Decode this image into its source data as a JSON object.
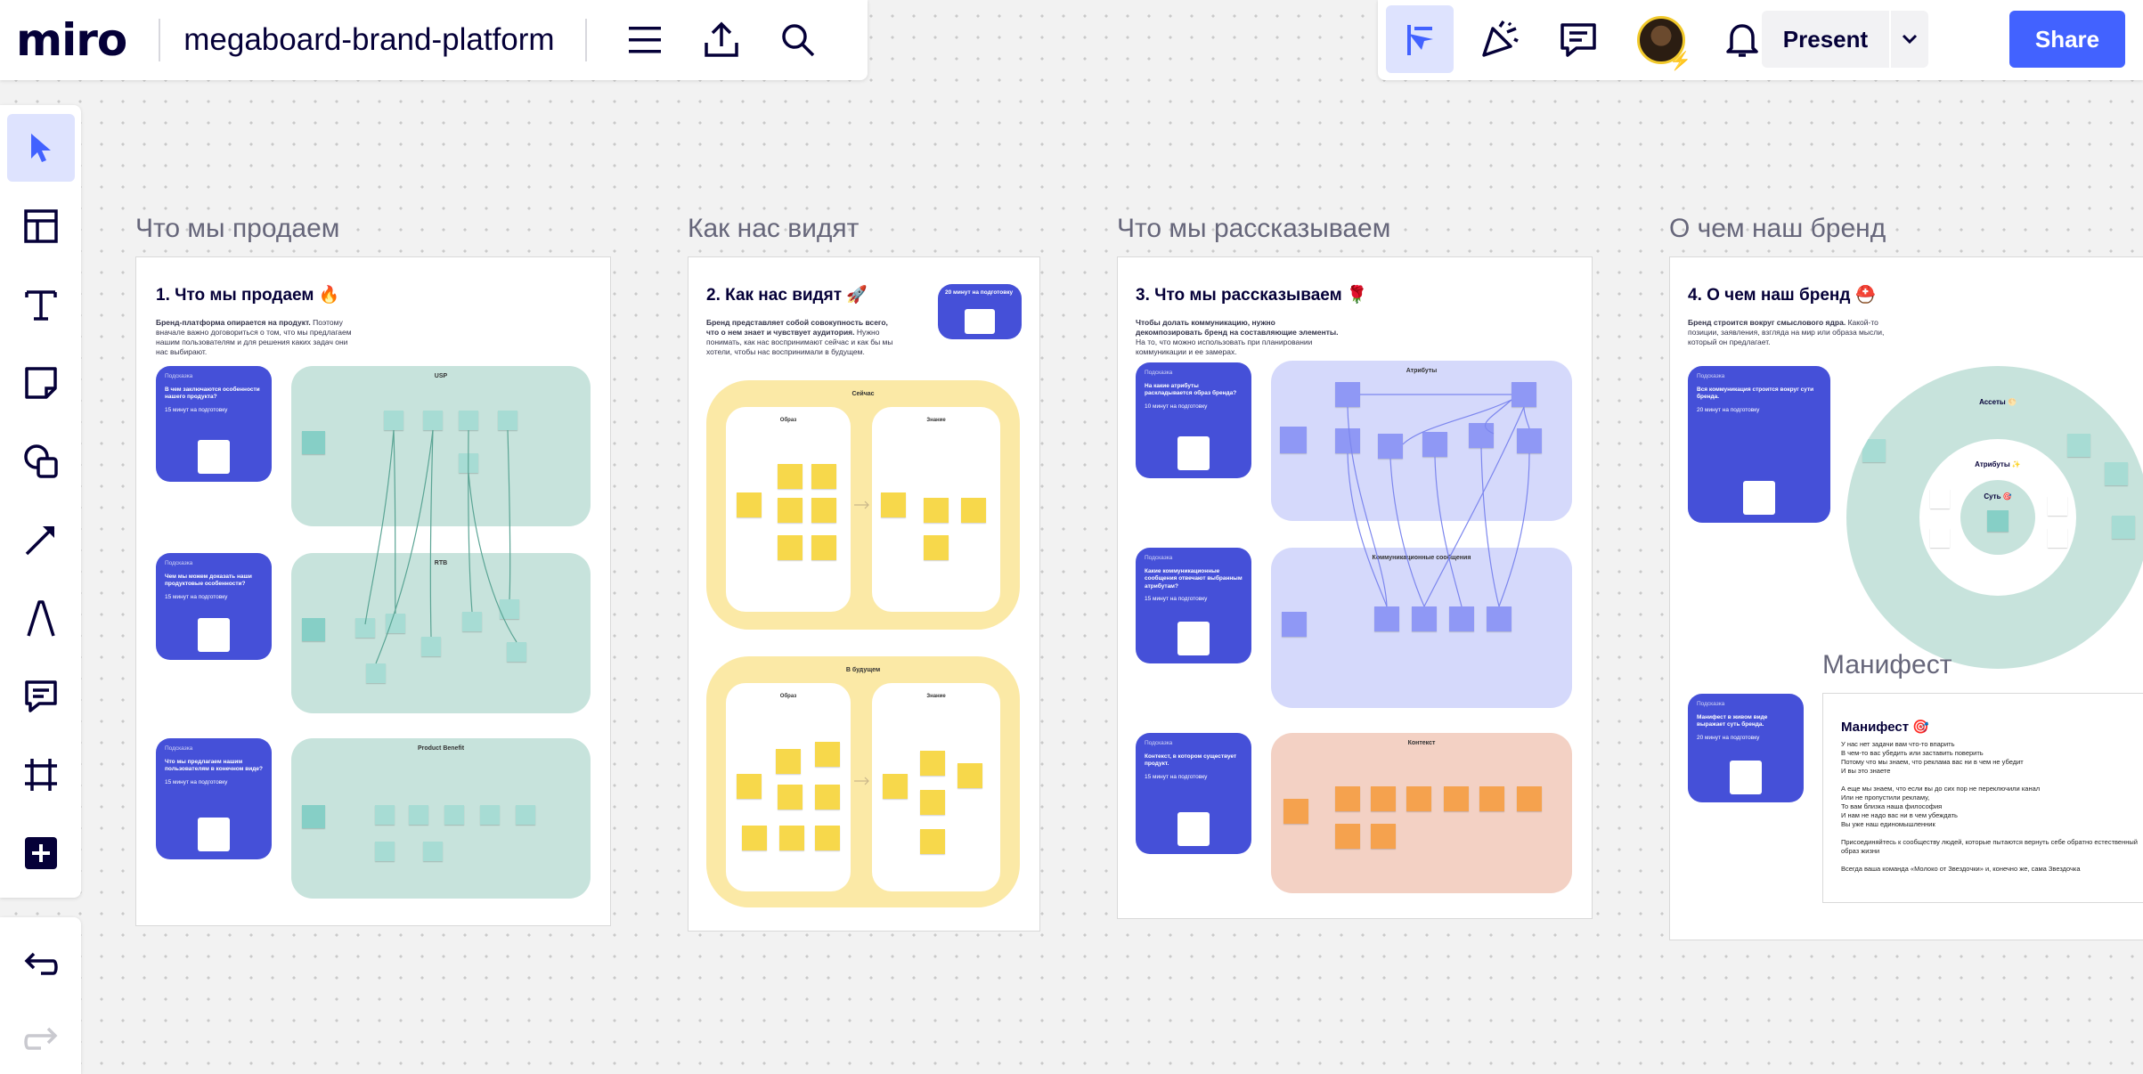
{
  "app": {
    "logo": "miro",
    "board_title": "megaboard-brand-platform",
    "present_label": "Present",
    "share_label": "Share"
  },
  "colors": {
    "accent": "#4262ff",
    "card_blue": "#4550d8",
    "teal_zone": "#c7e3dc",
    "yellow_zone": "#fbe9a6",
    "lavender_zone": "#d5d9fb",
    "peach_zone": "#f3d1c4"
  },
  "frames": [
    {
      "label": "Что мы продаем",
      "title": "1. Что мы продаем 🔥",
      "desc_bold": "Бренд-платформа опирается на продукт.",
      "desc": " Поэтому вначале важно договориться о том, что мы предлагаем нашим пользователям и для решения каких задач они нас выбирают.",
      "cards": [
        {
          "label": "Подсказка",
          "q": "В чем заключаются особенности нашего продукта?",
          "t": "15 минут на подготовку"
        },
        {
          "label": "Подсказка",
          "q": "Чем мы можем доказать наши продуктовые особенности?",
          "t": "15 минут на подготовку"
        },
        {
          "label": "Подсказка",
          "q": "Что мы предлагаем нашим пользователям в конечном виде?",
          "t": "15 минут на подготовку"
        }
      ],
      "zones": [
        "USP",
        "RTB",
        "Product Benefit"
      ]
    },
    {
      "label": "Как нас видят",
      "title": "2. Как нас видят 🚀",
      "desc_bold": "Бренд представляет собой совокупность всего, что о нем знает и чувствует аудитория.",
      "desc": " Нужно понимать, как нас воспринимают сейчас и как бы мы хотели, чтобы нас воспринимали в будущем.",
      "timer": "20 минут на подготовку",
      "zones": [
        "Сейчас",
        "В будущем"
      ],
      "inner": [
        "Образ",
        "Знание",
        "Образ",
        "Знание"
      ]
    },
    {
      "label": "Что мы рассказываем",
      "title": "3. Что мы рассказываем 🌹",
      "desc_bold": "Чтобы долать коммуникацию, нужно декомпозировать бренд на составляющие элементы.",
      "desc": " На то, что можно использовать при планировании коммуникации и ее замерах.",
      "cards": [
        {
          "label": "Подсказка",
          "q": "На какие атрибуты раскладывается образ бренда?",
          "t": "10 минут на подготовку"
        },
        {
          "label": "Подсказка",
          "q": "Какие коммуникационные сообщения отвечают выбранным атрибутам?",
          "t": "15 минут на подготовку"
        },
        {
          "label": "Подсказка",
          "q": "Контекст, в котором существует продукт.",
          "t": "15 минут на подготовку"
        }
      ],
      "zones": [
        "Атрибуты",
        "Коммуникационные сообщения",
        "Контекст"
      ]
    },
    {
      "label": "О чем наш бренд",
      "title": "4. О чем наш бренд ⛑️",
      "desc_bold": "Бренд строится вокруг смыслового ядра.",
      "desc": " Какой-то позиции, заявления, взгляда на мир или образа мысли, который он предлагает.",
      "cards": [
        {
          "label": "Подсказка",
          "q": "Вся коммуникация строится вокруг сути бренда.",
          "t": "20 минут на подготовку"
        },
        {
          "label": "Подсказка",
          "q": "Манифест в живом виде выражает суть бренда.",
          "t": "20 минут на подготовку"
        }
      ],
      "rings": [
        "Ассеты 🌕",
        "Атрибуты ✨",
        "Суть 🎯"
      ]
    }
  ],
  "manifest": {
    "label": "Манифест",
    "title": "Манифест 🎯",
    "text": "У нас нет задачи вам что-то впарить\nВ чем-то вас убедить или заставить поверить\nПотому что мы знаем, что реклама вас ни в чем не убедит\nИ вы это знаете\n\nА еще мы знаем, что если вы до сих пор не переключили канал\nИли не пропустили рекламу,\nТо вам близка наша философия\nИ нам не надо вас ни в чем убеждать\nВы уже наш единомышленник\n\nПрисоединяйтесь к сообществу людей, которые пытаются вернуть себе обратно естественный образ жизни\n\nВсегда ваша команда «Молоко от Звездочки» и, конечно же, сама Звездочка"
  }
}
